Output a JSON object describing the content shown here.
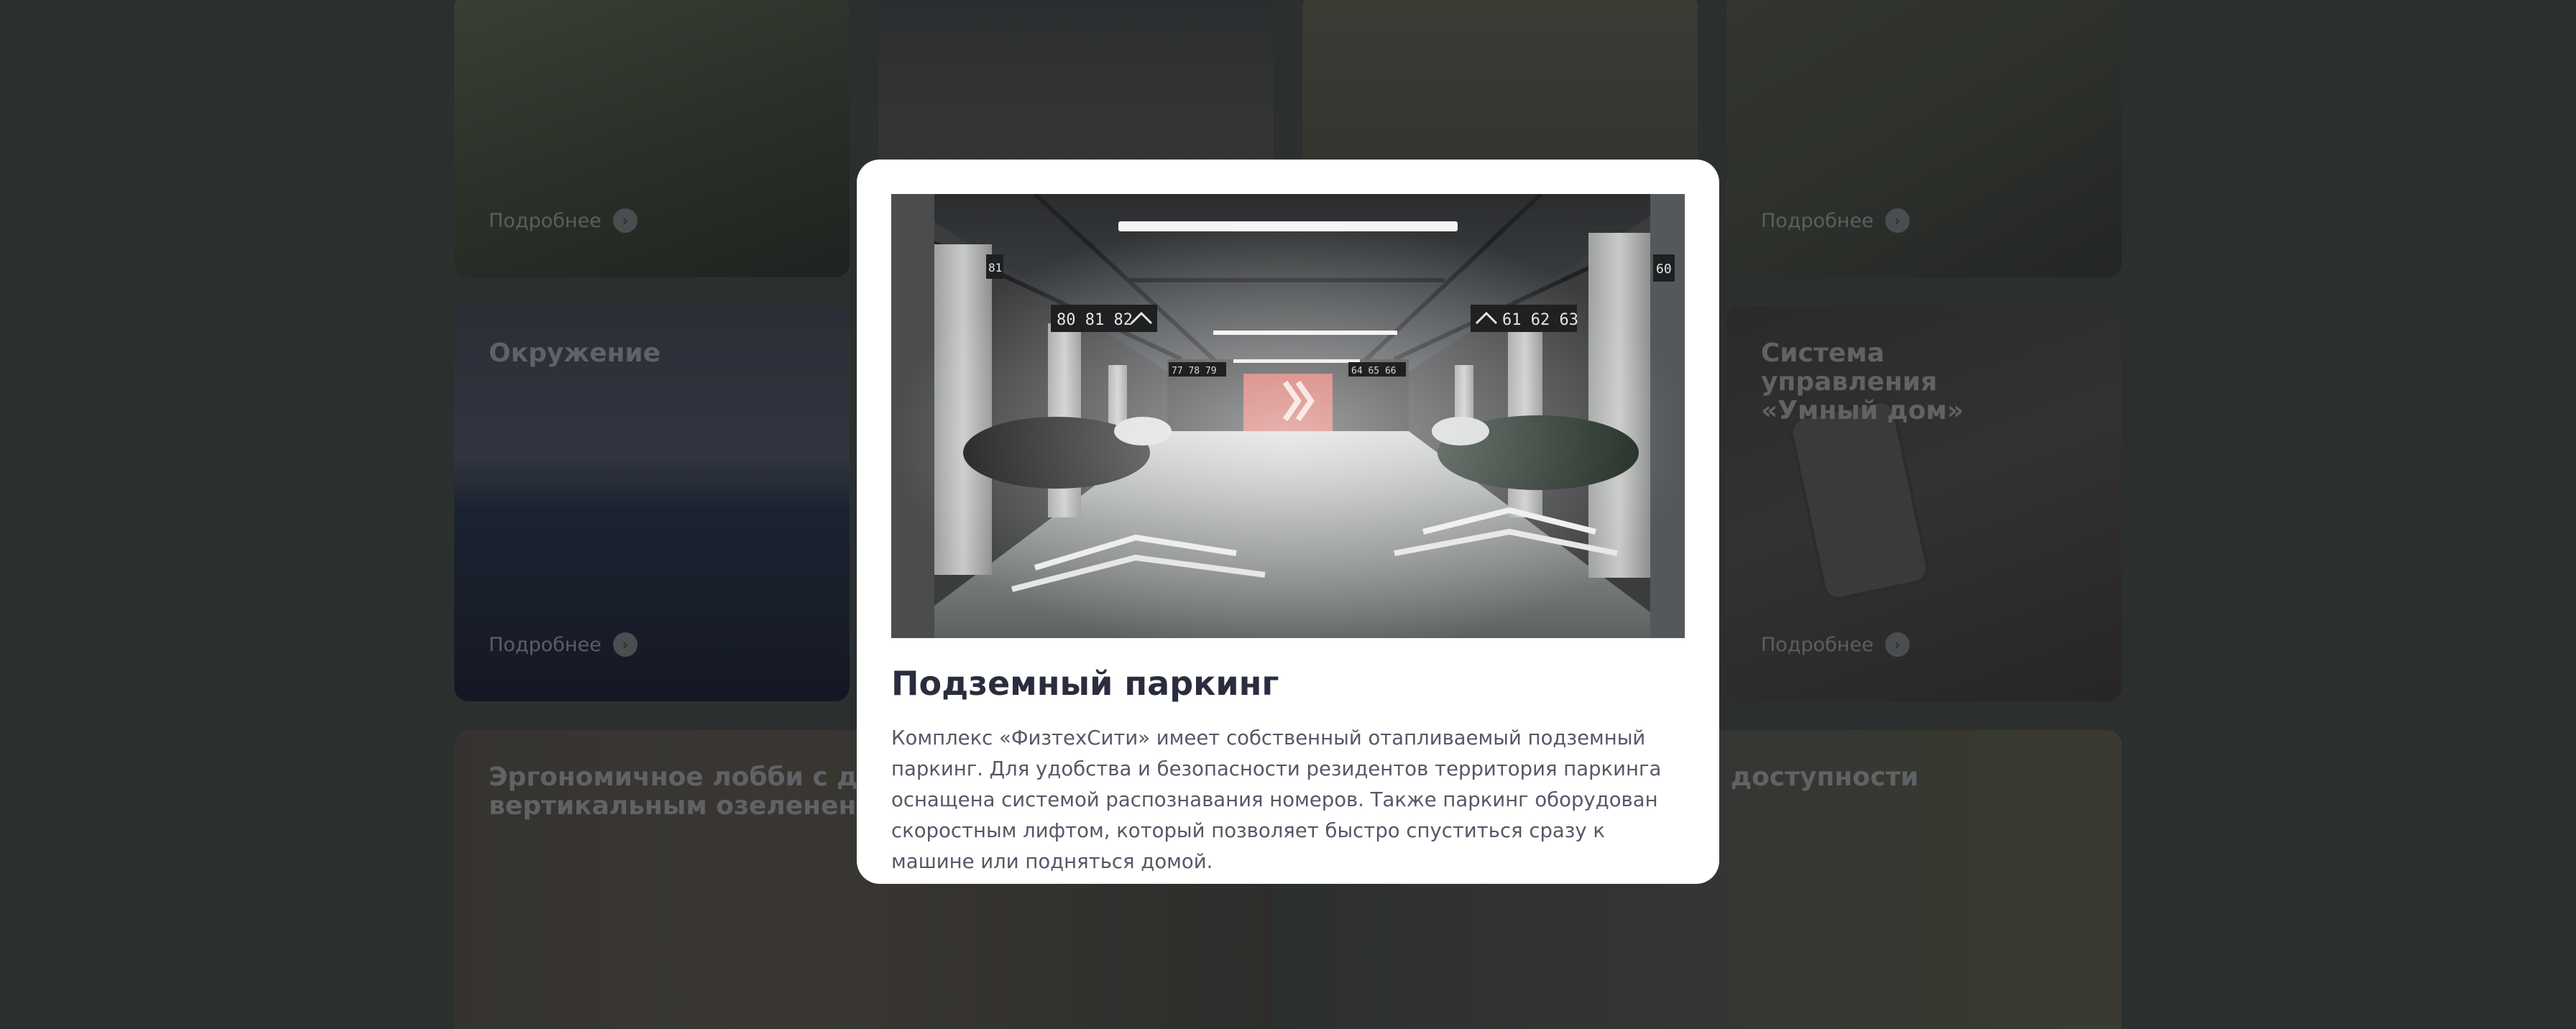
{
  "cards": {
    "more_label": "Подробнее",
    "arrow_glyph": "›",
    "environment_title": "Окружение",
    "smart_home_title": "Система управления «Умный дом»",
    "lobby_title": "Эргономичное лобби с дизайнерским вертикальным озеленением",
    "accessibility_title": "доступности"
  },
  "modal": {
    "title": "Подземный паркинг",
    "description": "Комплекс «ФизтехСити» имеет собственный отапливаемый подземный паркинг. Для удобства и безопасности резидентов территория паркинга оснащена системой распознавания номеров. Также паркинг оборудован скоростным лифтом, который позволяет быстро спуститься сразу к машине или подняться домой.",
    "signs": {
      "left_numbers": "80 81 82",
      "right_numbers": "61 62 63",
      "pillar_left": "81",
      "pillar_right": "60",
      "mid_left": "77 78 79",
      "mid_right": "64 65 66"
    }
  },
  "colors": {
    "overlay": "#2b2f2e",
    "modal_bg": "#ffffff",
    "title": "#2a2d3e",
    "text": "#555866",
    "parking_wall_red": "#c8574f"
  }
}
